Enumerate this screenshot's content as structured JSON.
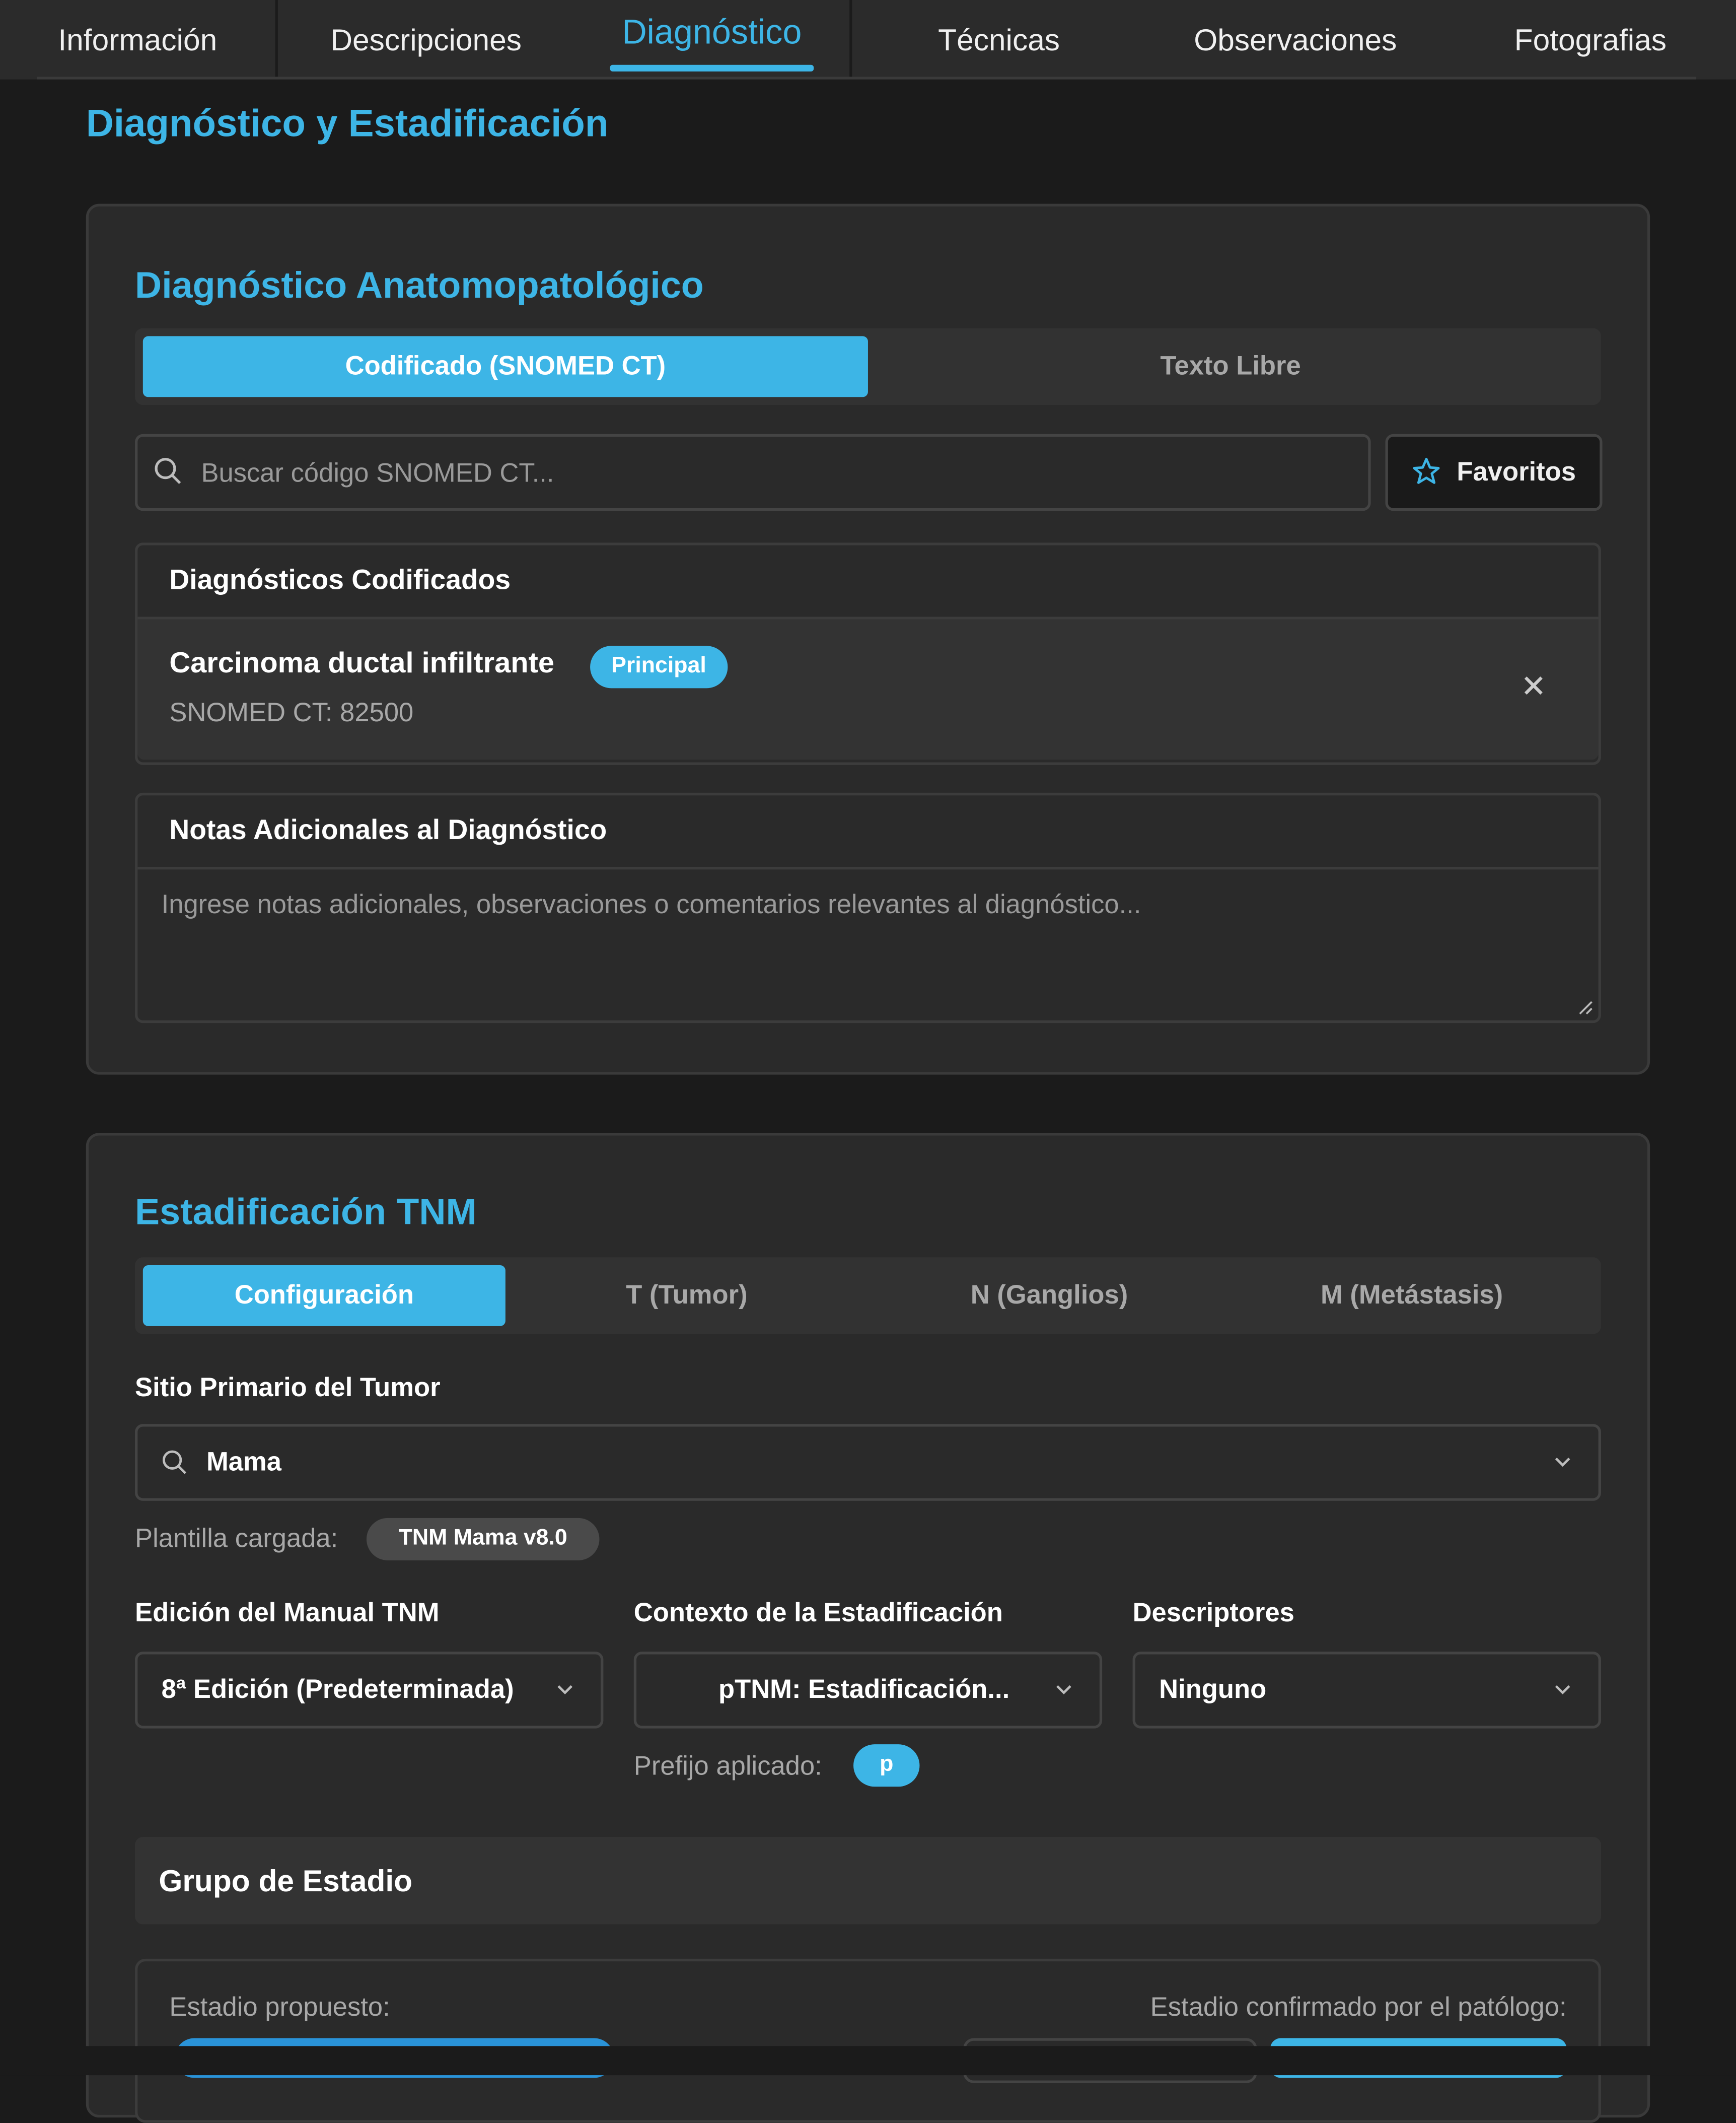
{
  "tabs": [
    {
      "label": "Información",
      "active": false
    },
    {
      "label": "Descripciones",
      "active": false
    },
    {
      "label": "Diagnóstico",
      "active": true
    },
    {
      "label": "Técnicas",
      "active": false
    },
    {
      "label": "Observaciones",
      "active": false
    },
    {
      "label": "Fotografias",
      "active": false
    }
  ],
  "page_title": "Diagnóstico y Estadificación",
  "diagnostico": {
    "title": "Diagnóstico Anatomopatológico",
    "mode_tabs": {
      "coded": "Codificado (SNOMED CT)",
      "free": "Texto Libre"
    },
    "search_placeholder": "Buscar código SNOMED CT...",
    "favorites_label": "Favoritos",
    "coded_header": "Diagnósticos Codificados",
    "coded_items": [
      {
        "name": "Carcinoma ductal infiltrante",
        "badge": "Principal",
        "code": "SNOMED CT: 82500"
      }
    ],
    "notes_header": "Notas Adicionales al Diagnóstico",
    "notes_placeholder": "Ingrese notas adicionales, observaciones o comentarios relevantes al diagnóstico..."
  },
  "tnm": {
    "title": "Estadificación TNM",
    "tabs": [
      "Configuración",
      "T (Tumor)",
      "N (Ganglios)",
      "M (Metástasis)"
    ],
    "site_label": "Sitio Primario del Tumor",
    "site_value": "Mama",
    "template_label": "Plantilla cargada:",
    "template_value": "TNM Mama v8.0",
    "edition_label": "Edición del Manual TNM",
    "edition_value": "8ª Edición (Predeterminada)",
    "context_label": "Contexto de la Estadificación",
    "context_value": "pTNM: Estadificación...",
    "descriptors_label": "Descriptores",
    "descriptors_value": "Ninguno",
    "prefix_label": "Prefijo aplicado:",
    "prefix_value": "p",
    "stage_group_title": "Grupo de Estadio",
    "proposed_label": "Estadio propuesto:",
    "confirmed_label": "Estadio confirmado por el patólogo:"
  },
  "colors": {
    "accent": "#3db5e6",
    "background": "#1b1b1b",
    "card": "#2a2a2a"
  }
}
